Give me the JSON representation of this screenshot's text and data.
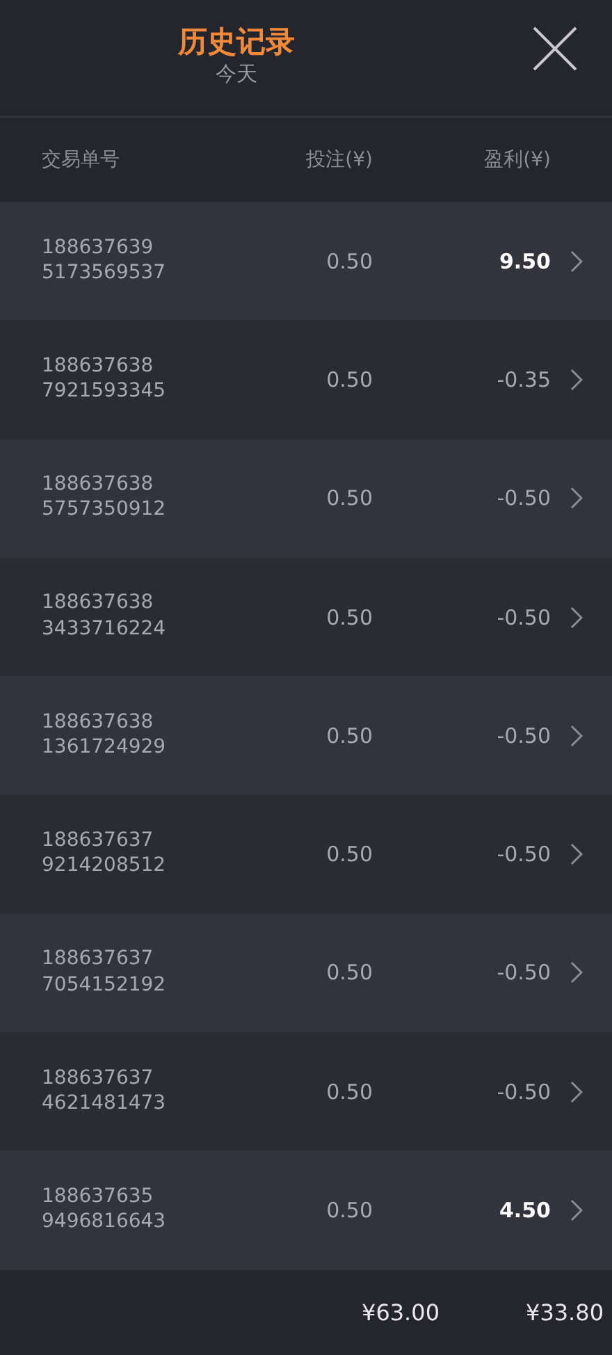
{
  "header": {
    "title": "历史记录",
    "subtitle": "今天"
  },
  "columns": [
    "交易单号",
    "投注(¥)",
    "盈利(¥)"
  ],
  "rows": [
    {
      "order_no": [
        "188637639",
        "5173569537"
      ],
      "stake": "0.50",
      "profit": "9.50",
      "kind": "win"
    },
    {
      "order_no": [
        "188637638",
        "7921593345"
      ],
      "stake": "0.50",
      "profit": "-0.35",
      "kind": "loss"
    },
    {
      "order_no": [
        "188637638",
        "5757350912"
      ],
      "stake": "0.50",
      "profit": "-0.50",
      "kind": "loss"
    },
    {
      "order_no": [
        "188637638",
        "3433716224"
      ],
      "stake": "0.50",
      "profit": "-0.50",
      "kind": "loss"
    },
    {
      "order_no": [
        "188637638",
        "1361724929"
      ],
      "stake": "0.50",
      "profit": "-0.50",
      "kind": "loss"
    },
    {
      "order_no": [
        "188637637",
        "9214208512"
      ],
      "stake": "0.50",
      "profit": "-0.50",
      "kind": "loss"
    },
    {
      "order_no": [
        "188637637",
        "7054152192"
      ],
      "stake": "0.50",
      "profit": "-0.50",
      "kind": "loss"
    },
    {
      "order_no": [
        "188637637",
        "4621481473"
      ],
      "stake": "0.50",
      "profit": "-0.50",
      "kind": "loss"
    },
    {
      "order_no": [
        "188637635",
        "9496816643"
      ],
      "stake": "0.50",
      "profit": "4.50",
      "kind": "win"
    }
  ],
  "totals": {
    "stake": "¥63.00",
    "profit": "¥33.80"
  }
}
